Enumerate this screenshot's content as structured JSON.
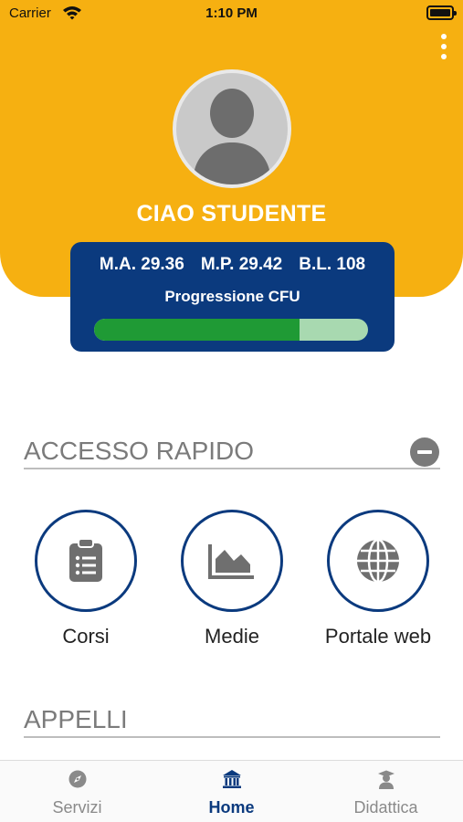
{
  "status_bar": {
    "carrier": "Carrier",
    "time": "1:10 PM"
  },
  "header": {
    "greeting": "CIAO STUDENTE",
    "background_color": "#f6b011"
  },
  "stats": {
    "media_aritmetica": "M.A. 29.36",
    "media_ponderata": "M.P. 29.42",
    "base_laurea": "B.L. 108",
    "progress_title": "Progressione CFU",
    "progress_fraction": 0.75,
    "card_color": "#0b3a7e",
    "progress_fill_color": "#1f9a35",
    "progress_track_color": "#a8d9b0"
  },
  "accesso_rapido": {
    "title": "ACCESSO RAPIDO",
    "items": [
      {
        "label": "Corsi",
        "icon": "clipboard-list-icon"
      },
      {
        "label": "Medie",
        "icon": "area-chart-icon"
      },
      {
        "label": "Portale web",
        "icon": "globe-icon"
      }
    ]
  },
  "appelli": {
    "title": "APPELLI"
  },
  "tab_bar": {
    "tabs": [
      {
        "label": "Servizi",
        "icon": "compass-icon",
        "active": false
      },
      {
        "label": "Home",
        "icon": "institution-icon",
        "active": true
      },
      {
        "label": "Didattica",
        "icon": "graduate-icon",
        "active": false
      }
    ],
    "active_color": "#0b3a7e"
  }
}
